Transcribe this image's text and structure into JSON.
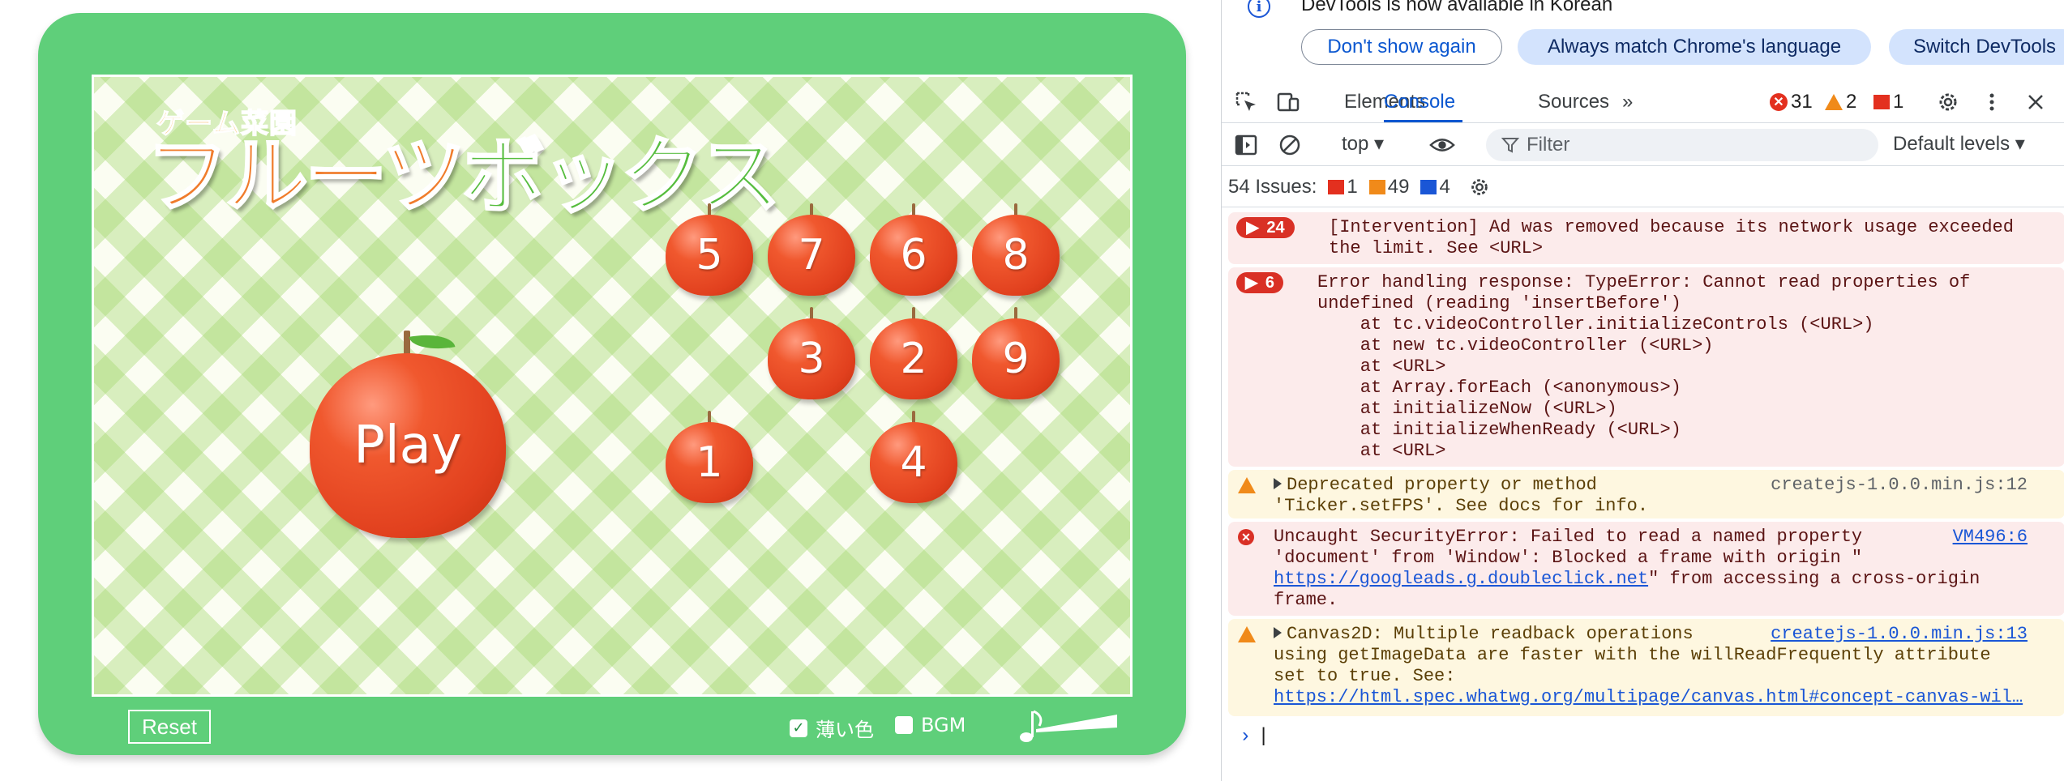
{
  "game": {
    "subtitle": "ゲーム菜園",
    "title_part1": "フルーツ",
    "title_part2": "ボックス",
    "play_label": "Play",
    "apples": [
      "5",
      "7",
      "6",
      "8",
      "3",
      "2",
      "9",
      "1",
      "4"
    ],
    "reset_label": "Reset",
    "option_light_label": "薄い色",
    "option_light_checked": true,
    "option_bgm_label": "BGM",
    "option_bgm_checked": false,
    "colors": {
      "frame": "#5fcf7a",
      "apple": "#e1401e",
      "title_orange": "#f07c2c",
      "title_green": "#56bd3e"
    }
  },
  "devtools": {
    "info_text": "DevTools is now available in Korean",
    "btn_dont_show": "Don't show again",
    "btn_match_lang": "Always match Chrome's language",
    "btn_switch": "Switch DevTools",
    "tabs": {
      "elements": "Elements",
      "console": "Console",
      "sources": "Sources"
    },
    "counts": {
      "errors": "31",
      "warnings": "2",
      "issues": "1"
    },
    "filter": {
      "context": "top",
      "placeholder": "Filter",
      "levels": "Default levels"
    },
    "issues": {
      "label": "54 Issues:",
      "errors": "1",
      "warnings": "49",
      "info": "4"
    },
    "messages": [
      {
        "count": "24",
        "lines": [
          "[Intervention] Ad was removed because its network usage exceeded",
          "the limit. See <URL>"
        ]
      },
      {
        "count": "6",
        "lines": [
          "Error handling response: TypeError: Cannot read properties of",
          "undefined (reading 'insertBefore')",
          "    at tc.videoController.initializeControls (<URL>)",
          "    at new tc.videoController (<URL>)",
          "    at <URL>",
          "    at Array.forEach (<anonymous>)",
          "    at initializeNow (<URL>)",
          "    at initializeWhenReady (<URL>)",
          "    at <URL>"
        ]
      },
      {
        "lines": [
          "Deprecated property or method",
          "'Ticker.setFPS'. See docs for info."
        ],
        "source": "createjs-1.0.0.min.js:12"
      },
      {
        "lines": [
          "Uncaught SecurityError: Failed to read a named property",
          "'document' from 'Window': Blocked a frame with origin \""
        ],
        "link": "https://googleads.g.doubleclick.net",
        "after_link": "\" from accessing a cross-origin",
        "last_line": "frame.",
        "source": "VM496:6"
      },
      {
        "lines": [
          "Canvas2D: Multiple readback operations",
          "using getImageData are faster with the willReadFrequently attribute",
          "set to true. See:"
        ],
        "link": "https://html.spec.whatwg.org/multipage/canvas.html#concept-canvas-wil…",
        "source": "createjs-1.0.0.min.js:13"
      }
    ],
    "prompt": "›"
  }
}
